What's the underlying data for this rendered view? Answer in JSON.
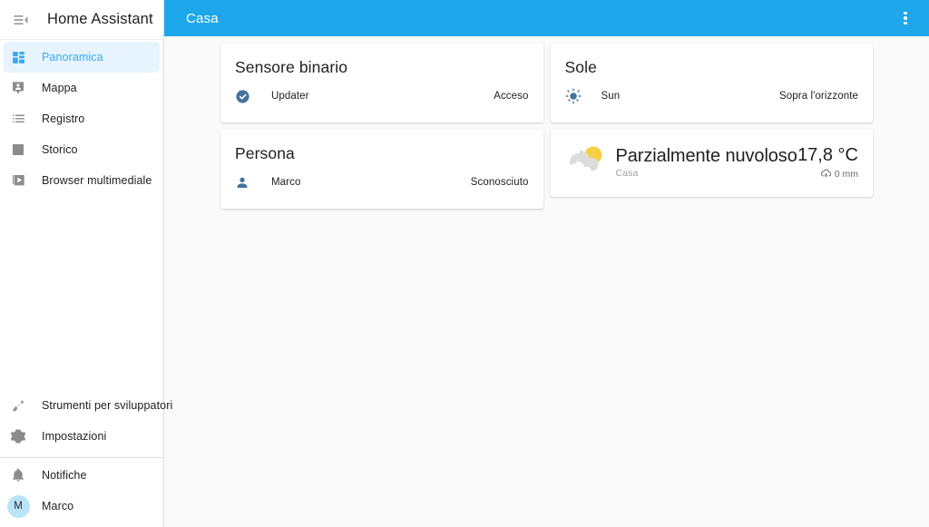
{
  "sidebar": {
    "menu_icon": "menu-open-icon",
    "title": "Home Assistant",
    "items": [
      {
        "label": "Panoramica",
        "icon": "view-dashboard-icon",
        "active": true
      },
      {
        "label": "Mappa",
        "icon": "map-marker-account-icon",
        "active": false
      },
      {
        "label": "Registro",
        "icon": "format-list-bulleted-icon",
        "active": false
      },
      {
        "label": "Storico",
        "icon": "chart-box-icon",
        "active": false
      },
      {
        "label": "Browser multimediale",
        "icon": "play-box-multiple-icon",
        "active": false
      }
    ],
    "tools": [
      {
        "label": "Strumenti per sviluppatori",
        "icon": "hammer-icon"
      },
      {
        "label": "Impostazioni",
        "icon": "gear-icon"
      }
    ],
    "footer": {
      "notifications_label": "Notifiche",
      "notifications_icon": "bell-icon",
      "user_label": "Marco",
      "user_initial": "M"
    }
  },
  "toolbar": {
    "title": "Casa",
    "overflow_icon": "dots-vertical-icon"
  },
  "cards": {
    "binary_sensor": {
      "title": "Sensore binario",
      "rows": [
        {
          "icon": "check-circle-icon",
          "name": "Updater",
          "state": "Acceso"
        }
      ]
    },
    "person": {
      "title": "Persona",
      "rows": [
        {
          "icon": "account-icon",
          "name": "Marco",
          "state": "Sconosciuto"
        }
      ]
    },
    "sun": {
      "title": "Sole",
      "rows": [
        {
          "icon": "weather-sunny-icon",
          "name": "Sun",
          "state": "Sopra l'orizzonte"
        }
      ]
    },
    "weather": {
      "icon": "weather-partly-cloudy-icon",
      "condition": "Parzialmente nuvoloso",
      "location": "Casa",
      "temperature": "17,8 °C",
      "precipitation": "0 mm",
      "precipitation_icon": "weather-rainy-icon"
    }
  },
  "colors": {
    "accent": "#1ea7ea",
    "active_nav": "#36a9f0",
    "active_nav_bg": "#e8f4fd",
    "state_icon": "#44739e",
    "page_bg": "#fafafa",
    "card_bg": "#ffffff",
    "avatar_bg": "#b9e4f7",
    "sun_yellow": "#f7cf45"
  }
}
